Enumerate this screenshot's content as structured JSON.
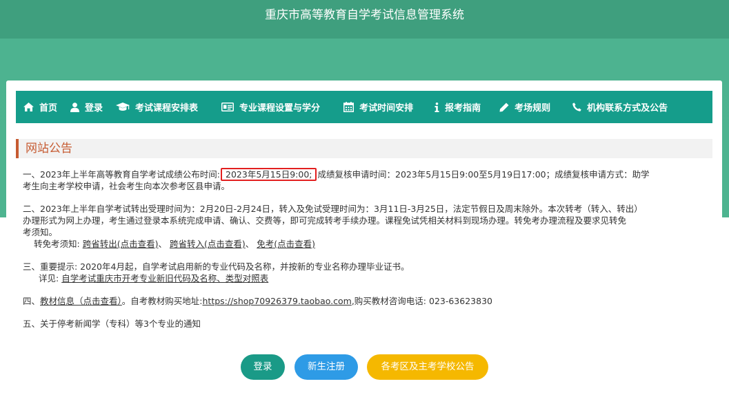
{
  "header": {
    "title": "重庆市高等教育自学考试信息管理系统"
  },
  "nav": [
    {
      "label": "首页",
      "icon": "home-icon"
    },
    {
      "label": "登录",
      "icon": "user-icon"
    },
    {
      "label": "考试课程安排表",
      "icon": "graduation-cap-icon"
    },
    {
      "label": "专业课程设置与学分",
      "icon": "id-card-icon"
    },
    {
      "label": "考试时间安排",
      "icon": "calendar-icon"
    },
    {
      "label": "报考指南",
      "icon": "info-icon"
    },
    {
      "label": "考场规则",
      "icon": "pencil-icon"
    },
    {
      "label": "机构联系方式及公告",
      "icon": "phone-icon"
    }
  ],
  "announcements": {
    "heading": "网站公告",
    "n1": {
      "prefix": "一、2023年上半年高等教育自学考试成绩公布时间:",
      "highlight": "2023年5月15日9:00;",
      "line1_rest": "成绩复核申请时间：2023年5月15日9:00至5月19日17:00；成绩复核申请方式：助学",
      "line2": "考生向主考学校申请，社会考生向本次参考区县申请。"
    },
    "n2": {
      "line1": "二、2023年上半年自学考试转出受理时间为：2月20日-2月24日，转入及免试受理时间为：3月11日-3月25日，法定节假日及周末除外。本次转考（转入、转出）",
      "line2": "办理形式为网上办理，考生通过登录本系统完成申请、确认、交费等，即可完成转考手续办理。课程免试凭相关材料到现场办理。转免考办理流程及要求见转免",
      "line3": "考须知。",
      "sub_prefix": "转免考须知:",
      "link1": "跨省转出(点击查看)",
      "sep1": "、",
      "link2": "跨省转入(点击查看)",
      "sep2": "、",
      "link3": "免考(点击查看)"
    },
    "n3": {
      "line1": "三、重要提示: 2020年4月起，自学考试启用新的专业代码及名称，并按新的专业名称办理毕业证书。",
      "sub_prefix": "详见:",
      "link": "自学考试重庆市开考专业新旧代码及名称、类型对照表"
    },
    "n4": {
      "prefix": "四、",
      "link1": "教材信息（点击查看）",
      "mid": "。自考教材购买地址:",
      "link2": "https://shop70926379.taobao.com",
      "suffix": ",购买教材咨询电话:  023-63623830"
    },
    "n5": {
      "text": "五、关于停考新闻学（专科）等3个专业的通知"
    }
  },
  "buttons": {
    "login": "登录",
    "register": "新生注册",
    "notices": "各考区及主考学校公告"
  },
  "colors": {
    "header_bg": "#3f9f7e",
    "nav_bg": "#159d8b",
    "section_accent": "#c65b32",
    "highlight_border": "#e21f1f",
    "btn_login": "#1a9a87",
    "btn_register": "#2e9be6",
    "btn_notices": "#f5b800"
  }
}
